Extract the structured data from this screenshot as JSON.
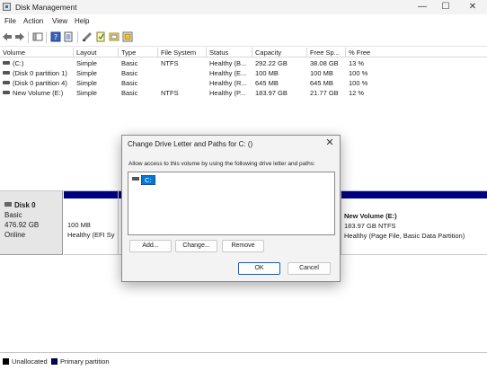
{
  "window": {
    "title": "Disk Management",
    "minimize_glyph": "—",
    "maximize_glyph": "☐",
    "close_glyph": "✕"
  },
  "menu": {
    "items": [
      "File",
      "Action",
      "View",
      "Help"
    ]
  },
  "toolbar": {
    "icons": [
      "back-arrow-icon",
      "forward-arrow-icon",
      "console-tree-icon",
      "help-icon",
      "properties-icon",
      "connect-icon",
      "rescan-icon",
      "check-icon"
    ]
  },
  "volumes": {
    "columns": [
      "Volume",
      "Layout",
      "Type",
      "File System",
      "Status",
      "Capacity",
      "Free Sp...",
      "% Free"
    ],
    "rows": [
      [
        "(C:)",
        "Simple",
        "Basic",
        "NTFS",
        "Healthy (B...",
        "292.22 GB",
        "38.08 GB",
        "13 %"
      ],
      [
        "(Disk 0 partition 1)",
        "Simple",
        "Basic",
        "",
        "Healthy (E...",
        "100 MB",
        "100 MB",
        "100 %"
      ],
      [
        "(Disk 0 partition 4)",
        "Simple",
        "Basic",
        "",
        "Healthy (R...",
        "645 MB",
        "645 MB",
        "100 %"
      ],
      [
        "New Volume (E:)",
        "Simple",
        "Basic",
        "NTFS",
        "Healthy (P...",
        "183.97 GB",
        "21.77 GB",
        "12 %"
      ]
    ]
  },
  "disk": {
    "name": "Disk 0",
    "type": "Basic",
    "size": "476.92 GB",
    "status": "Online",
    "partitions": [
      {
        "name": "",
        "size": "100 MB",
        "status": "Healthy (EFI Sy"
      },
      {
        "name": "New Volume  (E:)",
        "size": "183.97 GB NTFS",
        "status": "Healthy (Page File, Basic Data Partition)"
      }
    ]
  },
  "legend": {
    "unallocated": "Unallocated",
    "primary": "Primary partition",
    "unallocated_color": "#000000",
    "primary_color": "#000080"
  },
  "dialog": {
    "title": "Change Drive Letter and Paths for C: ()",
    "instruction": "Allow access to this volume by using the following drive letter and paths:",
    "list_item": "C:",
    "add_label": "Add...",
    "change_label": "Change...",
    "remove_label": "Remove",
    "ok_label": "OK",
    "cancel_label": "Cancel",
    "close_glyph": "✕"
  }
}
